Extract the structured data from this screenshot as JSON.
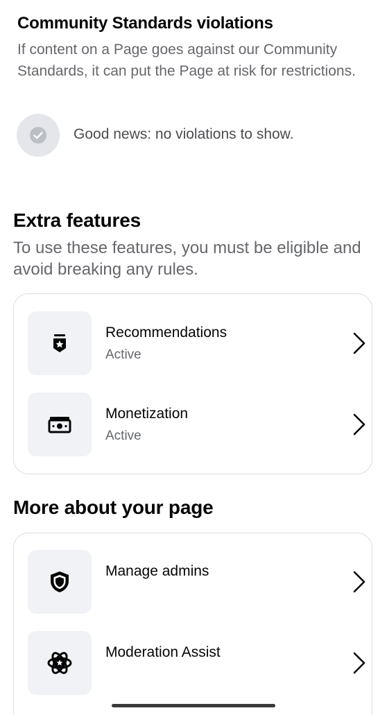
{
  "community_standards": {
    "title": "Community Standards violations",
    "description": "If content on a Page goes against our Community Standards, it can put the Page at risk for restrictions.",
    "status_text": "Good news: no violations to show.",
    "status_icon": "checkmark-circle-icon"
  },
  "extra_features": {
    "title": "Extra features",
    "description": "To use these features, you must be eligible and avoid breaking any rules.",
    "items": [
      {
        "label": "Recommendations",
        "status": "Active",
        "icon": "recommendations-badge-icon"
      },
      {
        "label": "Monetization",
        "status": "Active",
        "icon": "money-icon"
      }
    ]
  },
  "more_about": {
    "title": "More about your page",
    "items": [
      {
        "label": "Manage admins",
        "icon": "shield-icon"
      },
      {
        "label": "Moderation Assist",
        "icon": "moderation-assist-icon"
      }
    ]
  },
  "colors": {
    "primary_text": "#050505",
    "secondary_text": "#65676b",
    "icon_background": "#f0f2f5",
    "card_border": "#dadde1"
  }
}
